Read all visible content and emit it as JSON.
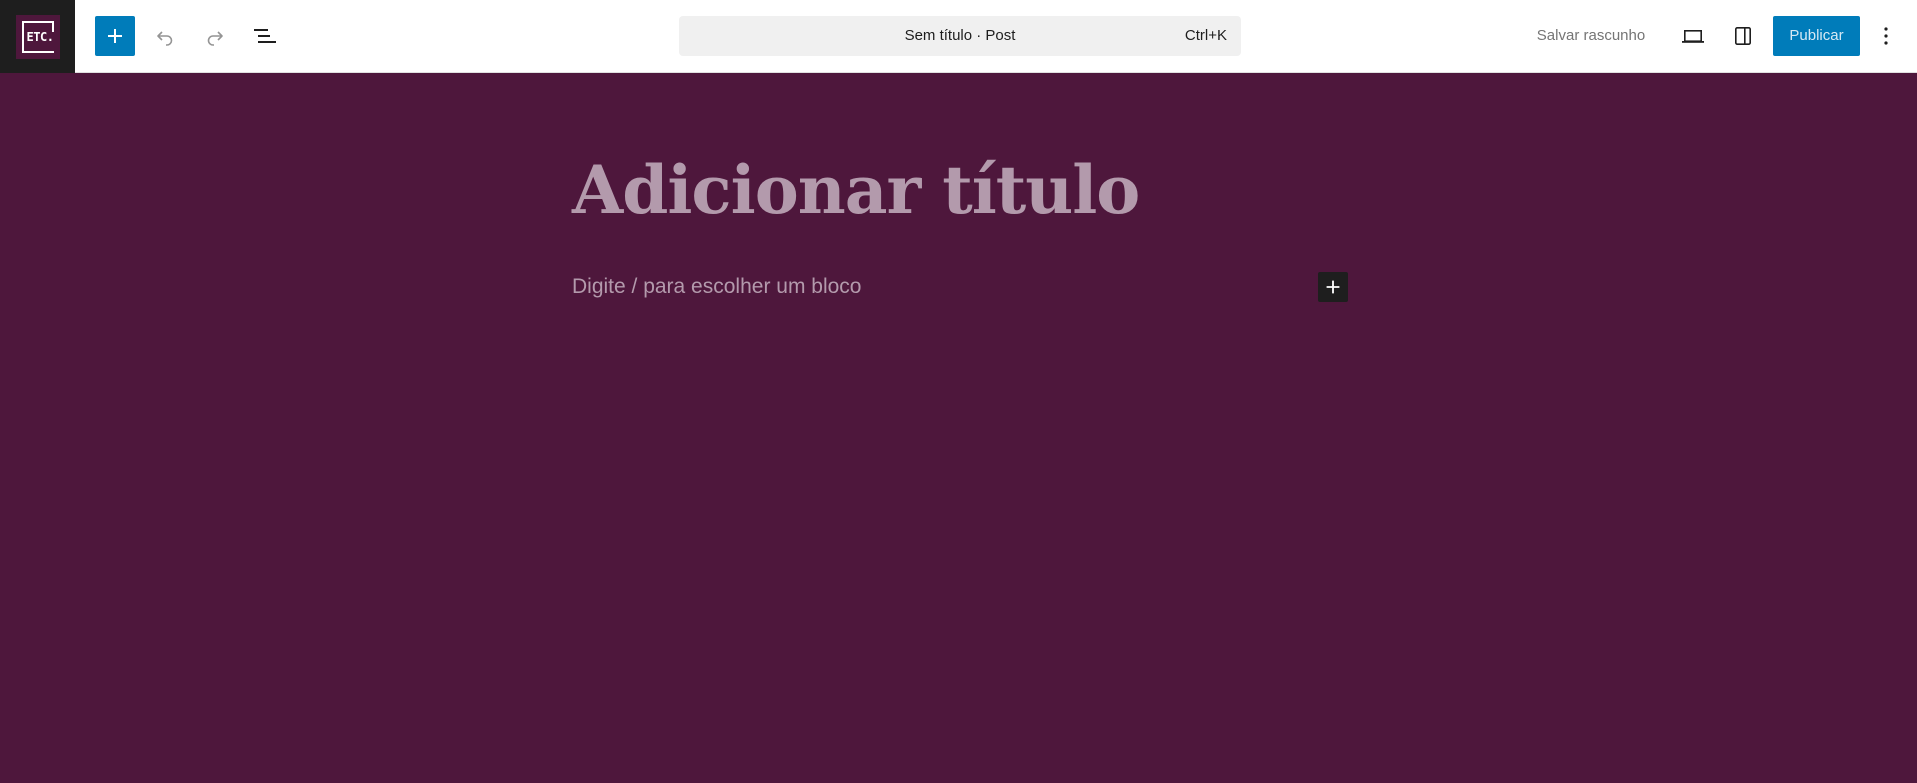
{
  "header": {
    "logo_text": "ETC.",
    "document_title": "Sem título · Post",
    "shortcut": "Ctrl+K",
    "save_draft_label": "Salvar rascunho",
    "publish_label": "Publicar"
  },
  "editor": {
    "title_placeholder": "Adicionar título",
    "block_placeholder": "Digite / para escolher um bloco"
  },
  "icons": {
    "inserter": "plus-icon",
    "undo": "undo-icon",
    "redo": "redo-icon",
    "list_view": "list-view-icon",
    "preview": "desktop-icon",
    "settings": "sidebar-icon",
    "options": "more-vertical-icon",
    "block_inserter": "plus-icon"
  },
  "colors": {
    "accent": "#007cba",
    "canvas_background": "#4e173c",
    "placeholder_text": "#b39aac",
    "logo_background": "#1e1e1e"
  }
}
